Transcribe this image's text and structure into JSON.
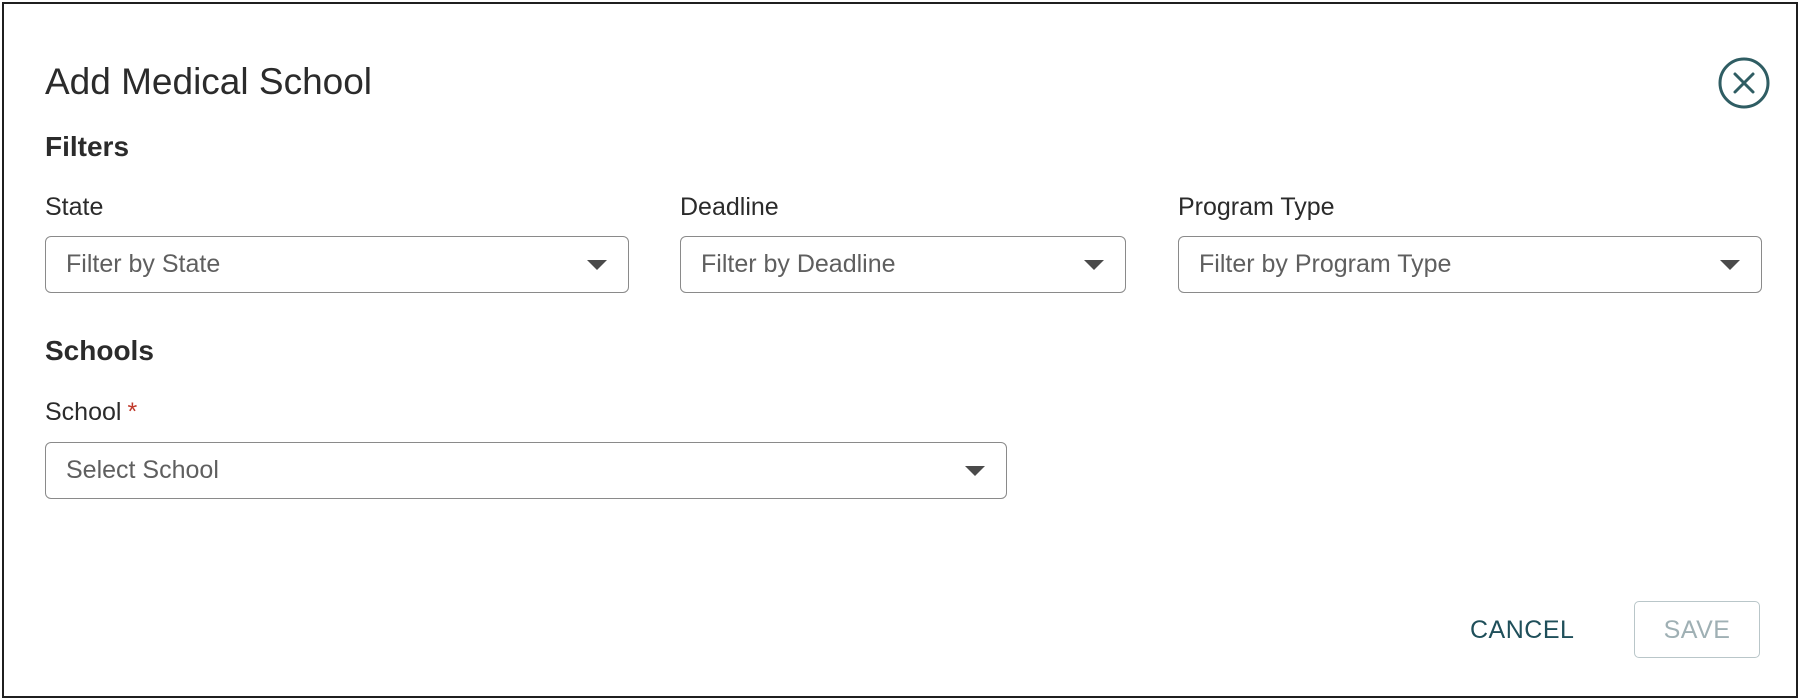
{
  "dialog": {
    "title": "Add Medical School",
    "close_icon": "close-circle-icon"
  },
  "filters": {
    "heading": "Filters",
    "state": {
      "label": "State",
      "placeholder": "Filter by State"
    },
    "deadline": {
      "label": "Deadline",
      "placeholder": "Filter by Deadline"
    },
    "program_type": {
      "label": "Program Type",
      "placeholder": "Filter by Program Type"
    }
  },
  "schools": {
    "heading": "Schools",
    "school": {
      "label": "School",
      "required_marker": "*",
      "placeholder": "Select School"
    }
  },
  "actions": {
    "cancel_label": "CANCEL",
    "save_label": "SAVE"
  },
  "colors": {
    "accent": "#1f4f5a",
    "required": "#c0392b",
    "disabled": "#9fb0b4"
  }
}
